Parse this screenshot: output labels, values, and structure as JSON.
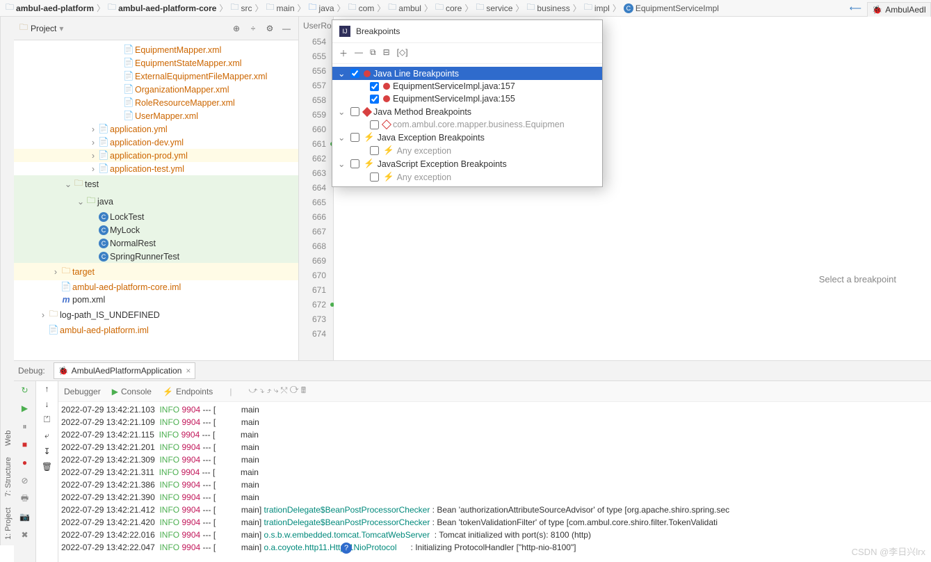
{
  "breadcrumb": [
    {
      "label": "ambul-aed-platform",
      "icon": "folder",
      "bold": true
    },
    {
      "label": "ambul-aed-platform-core",
      "icon": "folder",
      "bold": true
    },
    {
      "label": "src",
      "icon": "folder"
    },
    {
      "label": "main",
      "icon": "folder"
    },
    {
      "label": "java",
      "icon": "folder-blue"
    },
    {
      "label": "com",
      "icon": "folder"
    },
    {
      "label": "ambul",
      "icon": "folder"
    },
    {
      "label": "core",
      "icon": "folder"
    },
    {
      "label": "service",
      "icon": "folder"
    },
    {
      "label": "business",
      "icon": "folder"
    },
    {
      "label": "impl",
      "icon": "folder"
    },
    {
      "label": "EquipmentServiceImpl",
      "icon": "class"
    }
  ],
  "right_tab": {
    "label": "AmbulAedI"
  },
  "left_gutter": {
    "project": "1: Project",
    "structure": "7: Structure",
    "web": "Web"
  },
  "project_header": {
    "title": "Project",
    "tools": [
      "⊕",
      "÷",
      "⚙",
      "—"
    ]
  },
  "tree": [
    {
      "indent": 8,
      "icon": "xml",
      "label": "EquipmentMapper.xml",
      "orange": true
    },
    {
      "indent": 8,
      "icon": "xml",
      "label": "EquipmentStateMapper.xml",
      "orange": true
    },
    {
      "indent": 8,
      "icon": "xml",
      "label": "ExternalEquipmentFileMapper.xml",
      "orange": true
    },
    {
      "indent": 8,
      "icon": "xml",
      "label": "OrganizationMapper.xml",
      "orange": true
    },
    {
      "indent": 8,
      "icon": "xml",
      "label": "RoleResourceMapper.xml",
      "orange": true
    },
    {
      "indent": 8,
      "icon": "xml",
      "label": "UserMapper.xml",
      "orange": true
    },
    {
      "indent": 6,
      "icon": "yml",
      "label": "application.yml",
      "orange": true,
      "arrow": "col"
    },
    {
      "indent": 6,
      "icon": "yml",
      "label": "application-dev.yml",
      "orange": true,
      "arrow": "col"
    },
    {
      "indent": 6,
      "icon": "yml",
      "label": "application-prod.yml",
      "orange": true,
      "arrow": "col",
      "sel": "yellow"
    },
    {
      "indent": 6,
      "icon": "yml",
      "label": "application-test.yml",
      "orange": true,
      "arrow": "col"
    },
    {
      "indent": 4,
      "icon": "folder",
      "label": "test",
      "arrow": "exp",
      "sel": "green"
    },
    {
      "indent": 5,
      "icon": "folder-green",
      "label": "java",
      "arrow": "exp",
      "sel": "green"
    },
    {
      "indent": 6,
      "icon": "class",
      "label": "LockTest",
      "sel": "green"
    },
    {
      "indent": 6,
      "icon": "class",
      "label": "MyLock",
      "sel": "green"
    },
    {
      "indent": 6,
      "icon": "class-run",
      "label": "NormalRest",
      "sel": "green"
    },
    {
      "indent": 6,
      "icon": "class-run",
      "label": "SpringRunnerTest",
      "sel": "green"
    },
    {
      "indent": 3,
      "icon": "folder-orange",
      "label": "target",
      "arrow": "col",
      "orange": true,
      "sel": "yellow"
    },
    {
      "indent": 3,
      "icon": "iml",
      "label": "ambul-aed-platform-core.iml",
      "orange": true
    },
    {
      "indent": 3,
      "icon": "maven",
      "label": "pom.xml"
    },
    {
      "indent": 2,
      "icon": "folder",
      "label": "log-path_IS_UNDEFINED",
      "arrow": "col"
    },
    {
      "indent": 2,
      "icon": "iml",
      "label": "ambul-aed-platform.iml",
      "orange": true
    }
  ],
  "editor_tab": "UserRo",
  "gutter_lines": [
    "654",
    "655",
    "656",
    "657",
    "658",
    "659",
    "660",
    "661",
    "662",
    "663",
    "664",
    "665",
    "666",
    "667",
    "668",
    "669",
    "670",
    "671",
    "672",
    "673",
    "674"
  ],
  "gutter_marks": {
    "661": true,
    "672": true
  },
  "popup": {
    "title": "Breakpoints",
    "toolbar": [
      "＋",
      "—",
      "⧉",
      "⊟",
      "[◇]"
    ],
    "rows": [
      {
        "depth": 0,
        "arrow": "exp",
        "checked": true,
        "icon": "dot-red",
        "label": "Java Line Breakpoints",
        "selected": true
      },
      {
        "depth": 1,
        "checked": true,
        "icon": "dot-red",
        "label": "EquipmentServiceImpl.java:157"
      },
      {
        "depth": 1,
        "checked": true,
        "icon": "dot-red",
        "label": "EquipmentServiceImpl.java:155"
      },
      {
        "depth": 0,
        "arrow": "exp",
        "checked": false,
        "icon": "diamond",
        "label": "Java Method Breakpoints"
      },
      {
        "depth": 1,
        "checked": false,
        "icon": "diamond-outline",
        "label": "com.ambul.core.mapper.business.Equipmen",
        "gray": true
      },
      {
        "depth": 0,
        "arrow": "exp",
        "checked": false,
        "icon": "lightning",
        "label": "Java Exception Breakpoints"
      },
      {
        "depth": 1,
        "checked": false,
        "icon": "lightning",
        "label": "Any exception",
        "gray": true
      },
      {
        "depth": 0,
        "arrow": "exp",
        "checked": false,
        "icon": "lightning",
        "label": "JavaScript Exception Breakpoints"
      },
      {
        "depth": 1,
        "checked": false,
        "icon": "lightning",
        "label": "Any exception",
        "gray": true
      }
    ],
    "hint": "Select a breakpoint"
  },
  "debug": {
    "title": "Debug:",
    "run_config": "AmbulAedPlatformApplication",
    "subtabs": [
      "Debugger",
      "Console",
      "Endpoints"
    ],
    "logs": [
      {
        "time": "2022-07-29 13:42:21.103",
        "level": "INFO",
        "pid": "9904",
        "sep": "--- [",
        "thread": "main",
        "cls": "",
        "msg": ""
      },
      {
        "time": "2022-07-29 13:42:21.109",
        "level": "INFO",
        "pid": "9904",
        "sep": "--- [",
        "thread": "main",
        "cls": "",
        "msg": ""
      },
      {
        "time": "2022-07-29 13:42:21.115",
        "level": "INFO",
        "pid": "9904",
        "sep": "--- [",
        "thread": "main",
        "cls": "",
        "msg": ""
      },
      {
        "time": "2022-07-29 13:42:21.201",
        "level": "INFO",
        "pid": "9904",
        "sep": "--- [",
        "thread": "main",
        "cls": "",
        "msg": ""
      },
      {
        "time": "2022-07-29 13:42:21.309",
        "level": "INFO",
        "pid": "9904",
        "sep": "--- [",
        "thread": "main",
        "cls": "",
        "msg": ""
      },
      {
        "time": "2022-07-29 13:42:21.311",
        "level": "INFO",
        "pid": "9904",
        "sep": "--- [",
        "thread": "main",
        "cls": "",
        "msg": ""
      },
      {
        "time": "2022-07-29 13:42:21.386",
        "level": "INFO",
        "pid": "9904",
        "sep": "--- [",
        "thread": "main",
        "cls": "",
        "msg": ""
      },
      {
        "time": "2022-07-29 13:42:21.390",
        "level": "INFO",
        "pid": "9904",
        "sep": "--- [",
        "thread": "main",
        "cls": "",
        "msg": ""
      },
      {
        "time": "2022-07-29 13:42:21.412",
        "level": "INFO",
        "pid": "9904",
        "sep": "--- [",
        "thread": "main]",
        "cls": "trationDelegate$BeanPostProcessorChecker",
        "msg": " : Bean 'authorizationAttributeSourceAdvisor' of type [org.apache.shiro.spring.sec"
      },
      {
        "time": "2022-07-29 13:42:21.420",
        "level": "INFO",
        "pid": "9904",
        "sep": "--- [",
        "thread": "main]",
        "cls": "trationDelegate$BeanPostProcessorChecker",
        "msg": " : Bean 'tokenValidationFilter' of type [com.ambul.core.shiro.filter.TokenValidati"
      },
      {
        "time": "2022-07-29 13:42:22.016",
        "level": "INFO",
        "pid": "9904",
        "sep": "--- [",
        "thread": "main]",
        "cls": "o.s.b.w.embedded.tomcat.TomcatWebServer",
        "msg": "  : Tomcat initialized with port(s): 8100 (http)"
      },
      {
        "time": "2022-07-29 13:42:22.047",
        "level": "INFO",
        "pid": "9904",
        "sep": "--- [",
        "thread": "main]",
        "cls": "o.a.coyote.http11.Http11NioProtocol",
        "msg": "      : Initializing ProtocolHandler [\"http-nio-8100\"]"
      }
    ]
  },
  "watermark": "CSDN @李日兴lrx"
}
